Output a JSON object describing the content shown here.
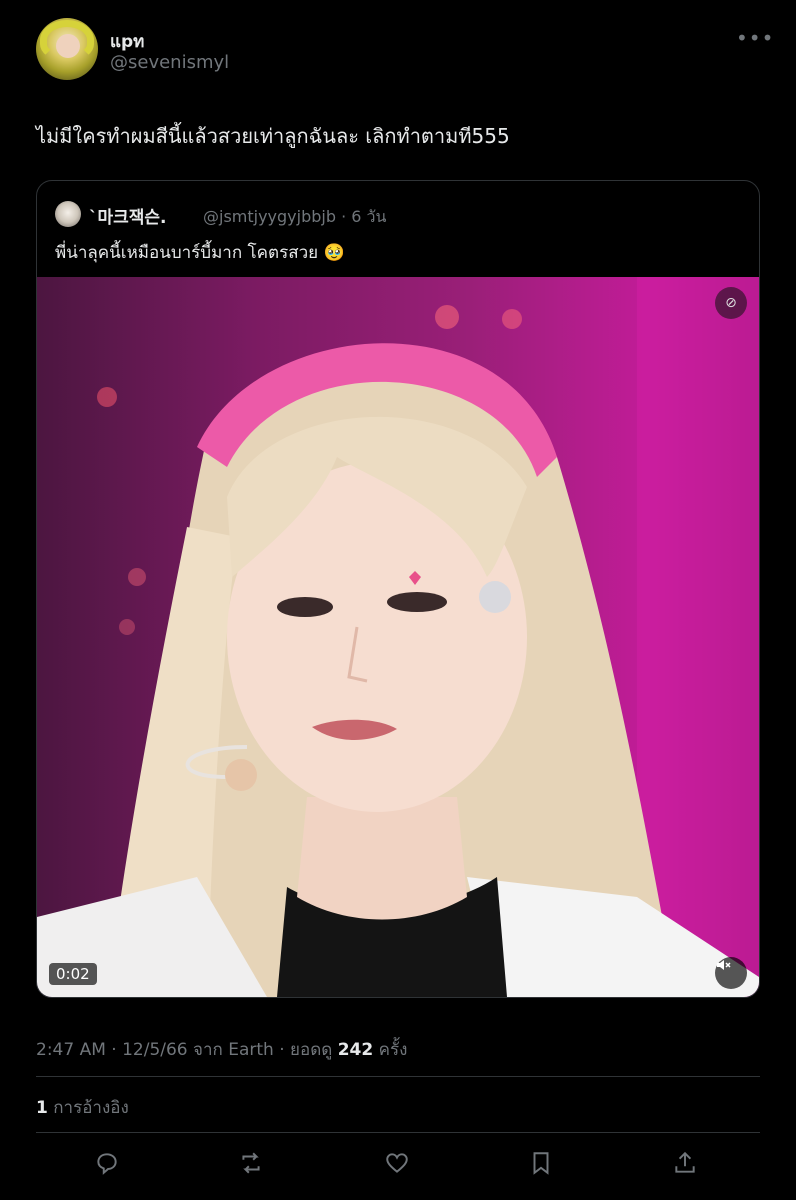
{
  "author": {
    "display_name": "แpท",
    "handle": "@sevenismyl"
  },
  "more_icon": "more-horizontal-icon",
  "tweet": {
    "text": "ไม่มีใครทำผมสีนี้แล้วสวยเท่าลูกฉันละ เลิกทำตามที555"
  },
  "quoted": {
    "display_name": "`마크잭슨.",
    "handle": "@jsmtjyygyjbbjb",
    "time": "· 6 วัน",
    "text": "พี่น่าลุคนี้เหมือนบาร์บี้มาก โคตรสวย 🥹",
    "media": {
      "duration": "0:02",
      "top_icon": "caption-off-icon",
      "mute_icon": "muted-speaker-icon"
    }
  },
  "meta": {
    "time": "2:47 AM · 12/5/66 จาก Earth · ยอดดู ",
    "views": "242",
    "views_suffix": " ครั้ง"
  },
  "quotes": {
    "count": "1",
    "label": " การอ้างอิง"
  },
  "actions": [
    "reply-icon",
    "retweet-icon",
    "like-icon",
    "bookmark-icon",
    "share-icon"
  ],
  "colors": {
    "background": "#000000",
    "text": "#e7e9ea",
    "secondary": "#71767b",
    "border": "#2f3336"
  }
}
